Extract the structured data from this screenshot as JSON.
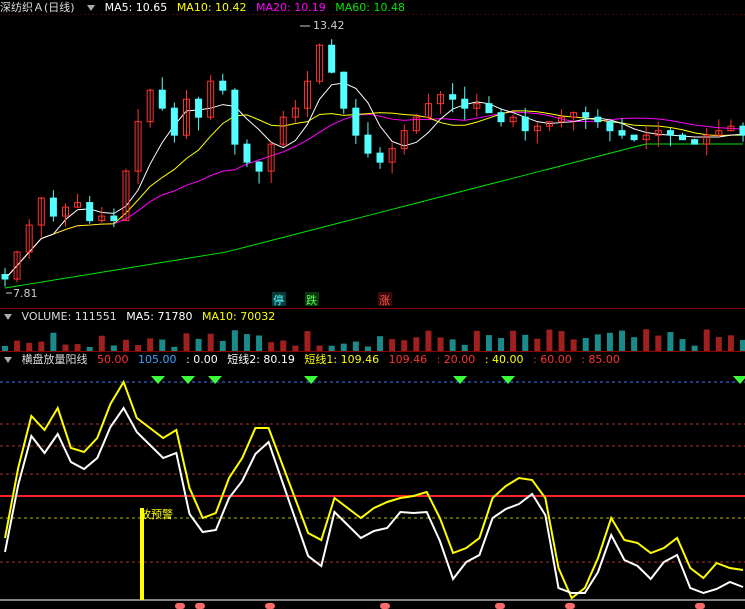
{
  "price_panel": {
    "title": "深纺织Ａ(日线)",
    "ma5_label": "MA5: 10.65",
    "ma10_label": "MA10: 10.42",
    "ma20_label": "MA20: 10.19",
    "ma60_label": "MA60: 10.48",
    "high_label": "13.42",
    "low_label": "7.81",
    "event_labels": [
      "停",
      "跌",
      "涨"
    ],
    "colors": {
      "up": "#ff3232",
      "down": "#54ffff",
      "ma5": "#ffffff",
      "ma10": "#ffff00",
      "ma20": "#ff00ff",
      "ma60": "#00e600"
    }
  },
  "volume_panel": {
    "title": "VOLUME: 111551",
    "ma5_label": "MA5: 71780",
    "ma10_label": "MA10: 70032"
  },
  "indicator_panel": {
    "title": "横盘放量阳线",
    "levels": [
      "50.00",
      "105.00",
      ": 0.00"
    ],
    "short2_label": "短线2: 80.19",
    "short1_label": "短线1: 109.46",
    "tail_levels": [
      "109.46",
      ": 20.00",
      ": 40.00",
      ": 60.00",
      ": 85.00"
    ],
    "warning_label": "放预警"
  }
}
